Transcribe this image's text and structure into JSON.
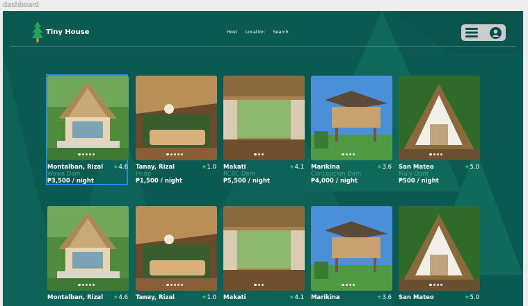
{
  "frame_label": "dashboard",
  "brand": {
    "name": "Tiny House"
  },
  "nav": [
    "Host",
    "Location",
    "Search"
  ],
  "icons": {
    "logo": "pine-tree-icon",
    "menu": "hamburger-menu-icon",
    "profile": "user-circle-icon",
    "rating": "star-icon"
  },
  "colors": {
    "background": "#0b5a52",
    "accent_star": "#2db36a",
    "selection": "#1e8fe6",
    "place_text": "#4aa29a"
  },
  "listings": [
    {
      "location": "Montalban, Rizal",
      "place": "Wawa Dam",
      "price": "₱3,500 / night",
      "rating": "4.6",
      "selected": true
    },
    {
      "location": "Tanay, Rizal",
      "place": "Hoop",
      "price": "₱1,500 / night",
      "rating": "1.0",
      "selected": false
    },
    {
      "location": "Makati",
      "place": "RCBC Dam",
      "price": "₱5,500 / night",
      "rating": "4.1",
      "selected": false
    },
    {
      "location": "Marikina",
      "place": "Concepcion Dam",
      "price": "₱4,000 / night",
      "rating": "3.6",
      "selected": false
    },
    {
      "location": "San Mateo",
      "place": "Maly Dam",
      "price": "₱500 / night",
      "rating": "5.0",
      "selected": false
    }
  ],
  "listings_row2": [
    {
      "location": "Montalban, Rizal",
      "rating": "4.6"
    },
    {
      "location": "Tanay, Rizal",
      "rating": "1.0"
    },
    {
      "location": "Makati",
      "rating": "4.1"
    },
    {
      "location": "Marikina",
      "rating": "3.6"
    },
    {
      "location": "San Mateo",
      "rating": "5.0"
    }
  ]
}
